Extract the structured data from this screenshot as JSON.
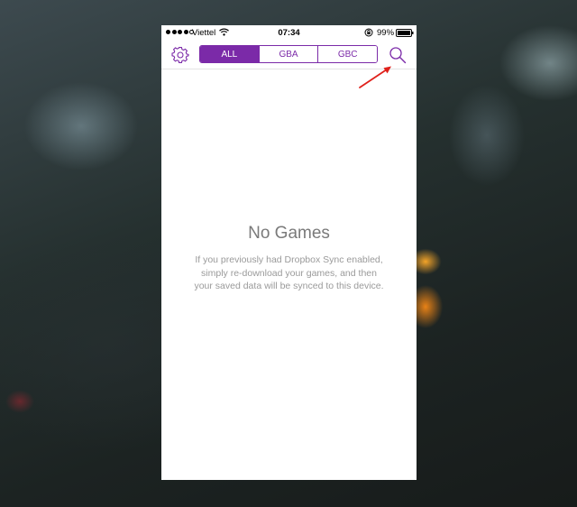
{
  "status_bar": {
    "carrier": "Viettel",
    "time": "07:34",
    "battery_percent": "99%",
    "signal_bars_filled": 4,
    "signal_bars_total": 5
  },
  "nav": {
    "settings_icon": "gear-icon",
    "search_icon": "search-icon",
    "tabs": [
      {
        "label": "ALL",
        "active": true
      },
      {
        "label": "GBA",
        "active": false
      },
      {
        "label": "GBC",
        "active": false
      }
    ]
  },
  "empty_state": {
    "title": "No Games",
    "message_lines": [
      "If you previously had Dropbox Sync enabled,",
      "simply re-download your games, and then",
      "your saved data will be synced to this device."
    ]
  },
  "colors": {
    "accent": "#7b2aa8",
    "annotation_arrow": "#e0211b"
  }
}
